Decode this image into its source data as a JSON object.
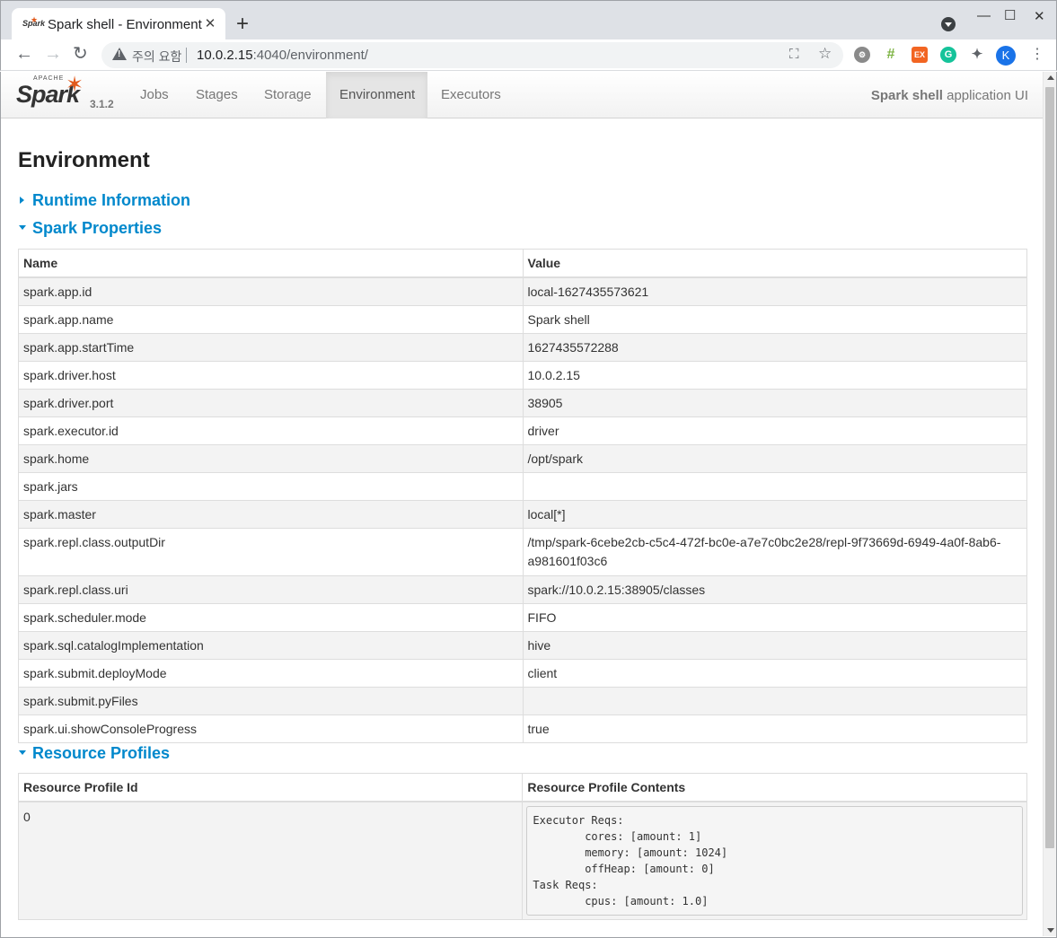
{
  "browser": {
    "tab_title": "Spark shell - Environment",
    "security_label": "주의 요함",
    "url_host": "10.0.2.15",
    "url_rest": ":4040/environment/",
    "profile_initial": "K",
    "extensions": [
      "settings-ext-icon",
      "ladder-ext-icon",
      "ex-ext-icon",
      "grammarly-ext-icon",
      "puzzle-icon"
    ],
    "ex_label": "EX"
  },
  "spark_ui": {
    "version": "3.1.2",
    "nav_tabs": [
      "Jobs",
      "Stages",
      "Storage",
      "Environment",
      "Executors"
    ],
    "active_tab": "Environment",
    "app_name": "Spark shell",
    "app_suffix": " application UI"
  },
  "page": {
    "title": "Environment",
    "sections": {
      "runtime": "Runtime Information",
      "spark_properties": "Spark Properties",
      "resource_profiles": "Resource Profiles"
    }
  },
  "spark_properties": {
    "headers": [
      "Name",
      "Value"
    ],
    "rows": [
      [
        "spark.app.id",
        "local-1627435573621"
      ],
      [
        "spark.app.name",
        "Spark shell"
      ],
      [
        "spark.app.startTime",
        "1627435572288"
      ],
      [
        "spark.driver.host",
        "10.0.2.15"
      ],
      [
        "spark.driver.port",
        "38905"
      ],
      [
        "spark.executor.id",
        "driver"
      ],
      [
        "spark.home",
        "/opt/spark"
      ],
      [
        "spark.jars",
        ""
      ],
      [
        "spark.master",
        "local[*]"
      ],
      [
        "spark.repl.class.outputDir",
        "/tmp/spark-6cebe2cb-c5c4-472f-bc0e-a7e7c0bc2e28/repl-9f73669d-6949-4a0f-8ab6-a981601f03c6"
      ],
      [
        "spark.repl.class.uri",
        "spark://10.0.2.15:38905/classes"
      ],
      [
        "spark.scheduler.mode",
        "FIFO"
      ],
      [
        "spark.sql.catalogImplementation",
        "hive"
      ],
      [
        "spark.submit.deployMode",
        "client"
      ],
      [
        "spark.submit.pyFiles",
        ""
      ],
      [
        "spark.ui.showConsoleProgress",
        "true"
      ]
    ]
  },
  "resource_profiles": {
    "headers": [
      "Resource Profile Id",
      "Resource Profile Contents"
    ],
    "rows": [
      {
        "id": "0",
        "contents": "Executor Reqs:\n\tcores: [amount: 1]\n\tmemory: [amount: 1024]\n\toffHeap: [amount: 0]\nTask Reqs:\n\tcpus: [amount: 1.0]"
      }
    ]
  },
  "colors": {
    "link": "#0088cc",
    "spark_orange": "#e25a1c"
  }
}
